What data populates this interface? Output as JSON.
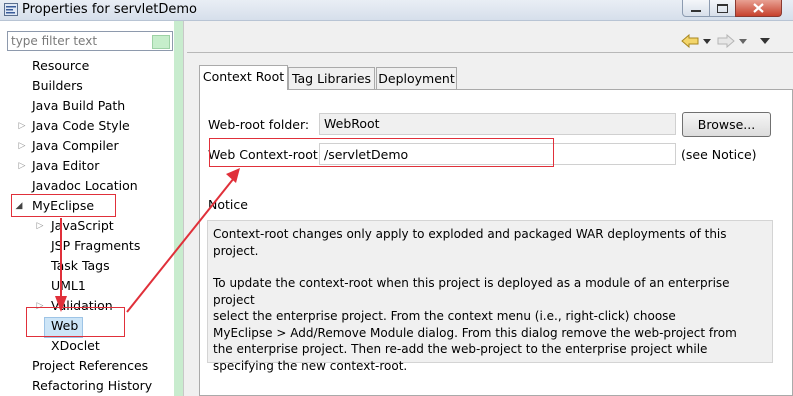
{
  "window": {
    "title": "Properties for servletDemo"
  },
  "filter": {
    "placeholder": "type filter text"
  },
  "tree": {
    "items": [
      {
        "label": "Resource"
      },
      {
        "label": "Builders"
      },
      {
        "label": "Java Build Path"
      },
      {
        "label": "Java Code Style"
      },
      {
        "label": "Java Compiler"
      },
      {
        "label": "Java Editor"
      },
      {
        "label": "Javadoc Location"
      },
      {
        "label": "MyEclipse"
      },
      {
        "label": "JavaScript"
      },
      {
        "label": "JSP Fragments"
      },
      {
        "label": "Task Tags"
      },
      {
        "label": "UML1"
      },
      {
        "label": "Validation"
      },
      {
        "label": "Web"
      },
      {
        "label": "XDoclet"
      },
      {
        "label": "Project References"
      },
      {
        "label": "Refactoring History"
      }
    ],
    "selected": "Web"
  },
  "tabs": [
    {
      "label": "Context Root"
    },
    {
      "label": "Tag Libraries"
    },
    {
      "label": "Deployment"
    }
  ],
  "form": {
    "web_root_label": "Web-root folder:",
    "web_root_value": "WebRoot",
    "browse_label": "Browse...",
    "context_root_label": "Web Context-root:",
    "context_root_value": "/servletDemo",
    "see_notice": "(see Notice)"
  },
  "notice": {
    "title": "Notice",
    "paragraph1": "Context-root changes only apply to exploded and packaged WAR deployments of this project.",
    "paragraph2_lines": [
      "To update the context-root when this project is deployed as a module of an enterprise project",
      "select the enterprise project. From the context menu (i.e., right-click) choose",
      "MyEclipse > Add/Remove Module dialog. From this dialog remove the web-project from",
      "the enterprise project. Then re-add the web-project to the enterprise project while",
      "specifying the new context-root."
    ]
  },
  "colors": {
    "annotation_red": "#e0303a",
    "selection_bg": "#cde5f7",
    "scrollbar_green": "#c8ecce"
  },
  "icons": [
    "app-icon",
    "back-arrow-icon",
    "forward-arrow-icon",
    "view-menu-icon",
    "tree-expand-icon"
  ]
}
